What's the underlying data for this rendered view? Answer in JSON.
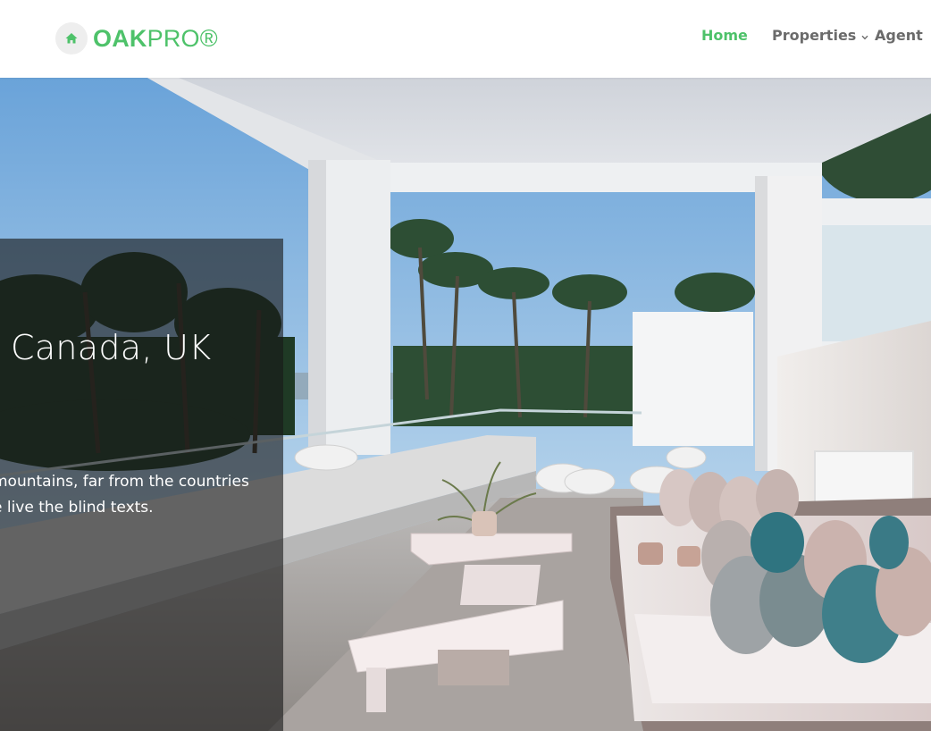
{
  "brand": {
    "name_bold": "OAK",
    "name_light": "PRO®",
    "accent_color": "#4ec26a",
    "icon": "home-icon"
  },
  "nav": {
    "items": [
      {
        "label": "Home",
        "active": true
      },
      {
        "label": "Properties",
        "has_dropdown": true,
        "dropdown_icon": "chevron-down-icon"
      },
      {
        "label": "Agent"
      }
    ]
  },
  "hero": {
    "title": "Canada, UK",
    "text_line_1": "mountains, far from the countries",
    "text_line_2": "e live the blind texts."
  }
}
